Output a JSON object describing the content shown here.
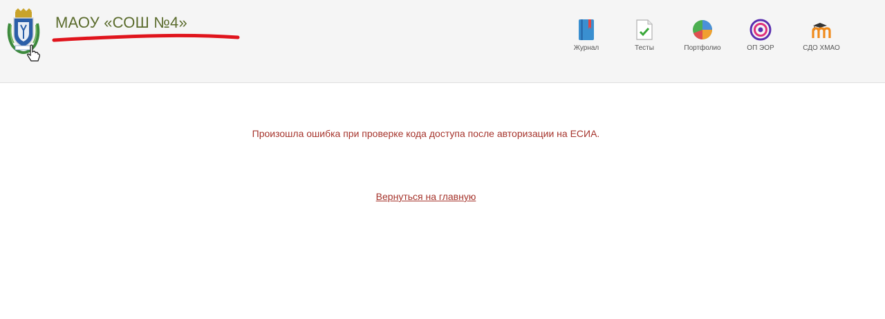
{
  "header": {
    "school_name": "МАОУ «СОШ №4»",
    "subtitle": "",
    "emblem_icon": "coat-of-arms-icon",
    "redaction_color": "#e0141c"
  },
  "nav": [
    {
      "label": "Журнал",
      "icon": "journal-icon"
    },
    {
      "label": "Тесты",
      "icon": "tests-icon"
    },
    {
      "label": "Портфолио",
      "icon": "portfolio-icon"
    },
    {
      "label": "ОП ЭОР",
      "icon": "target-icon"
    },
    {
      "label": "СДО ХМАО",
      "icon": "moodle-icon"
    }
  ],
  "main": {
    "error_message": "Произошла ошибка при проверке кода доступа после авторизации на ЕСИА.",
    "home_link": "Вернуться на главную",
    "accent_color": "#a5332b"
  }
}
